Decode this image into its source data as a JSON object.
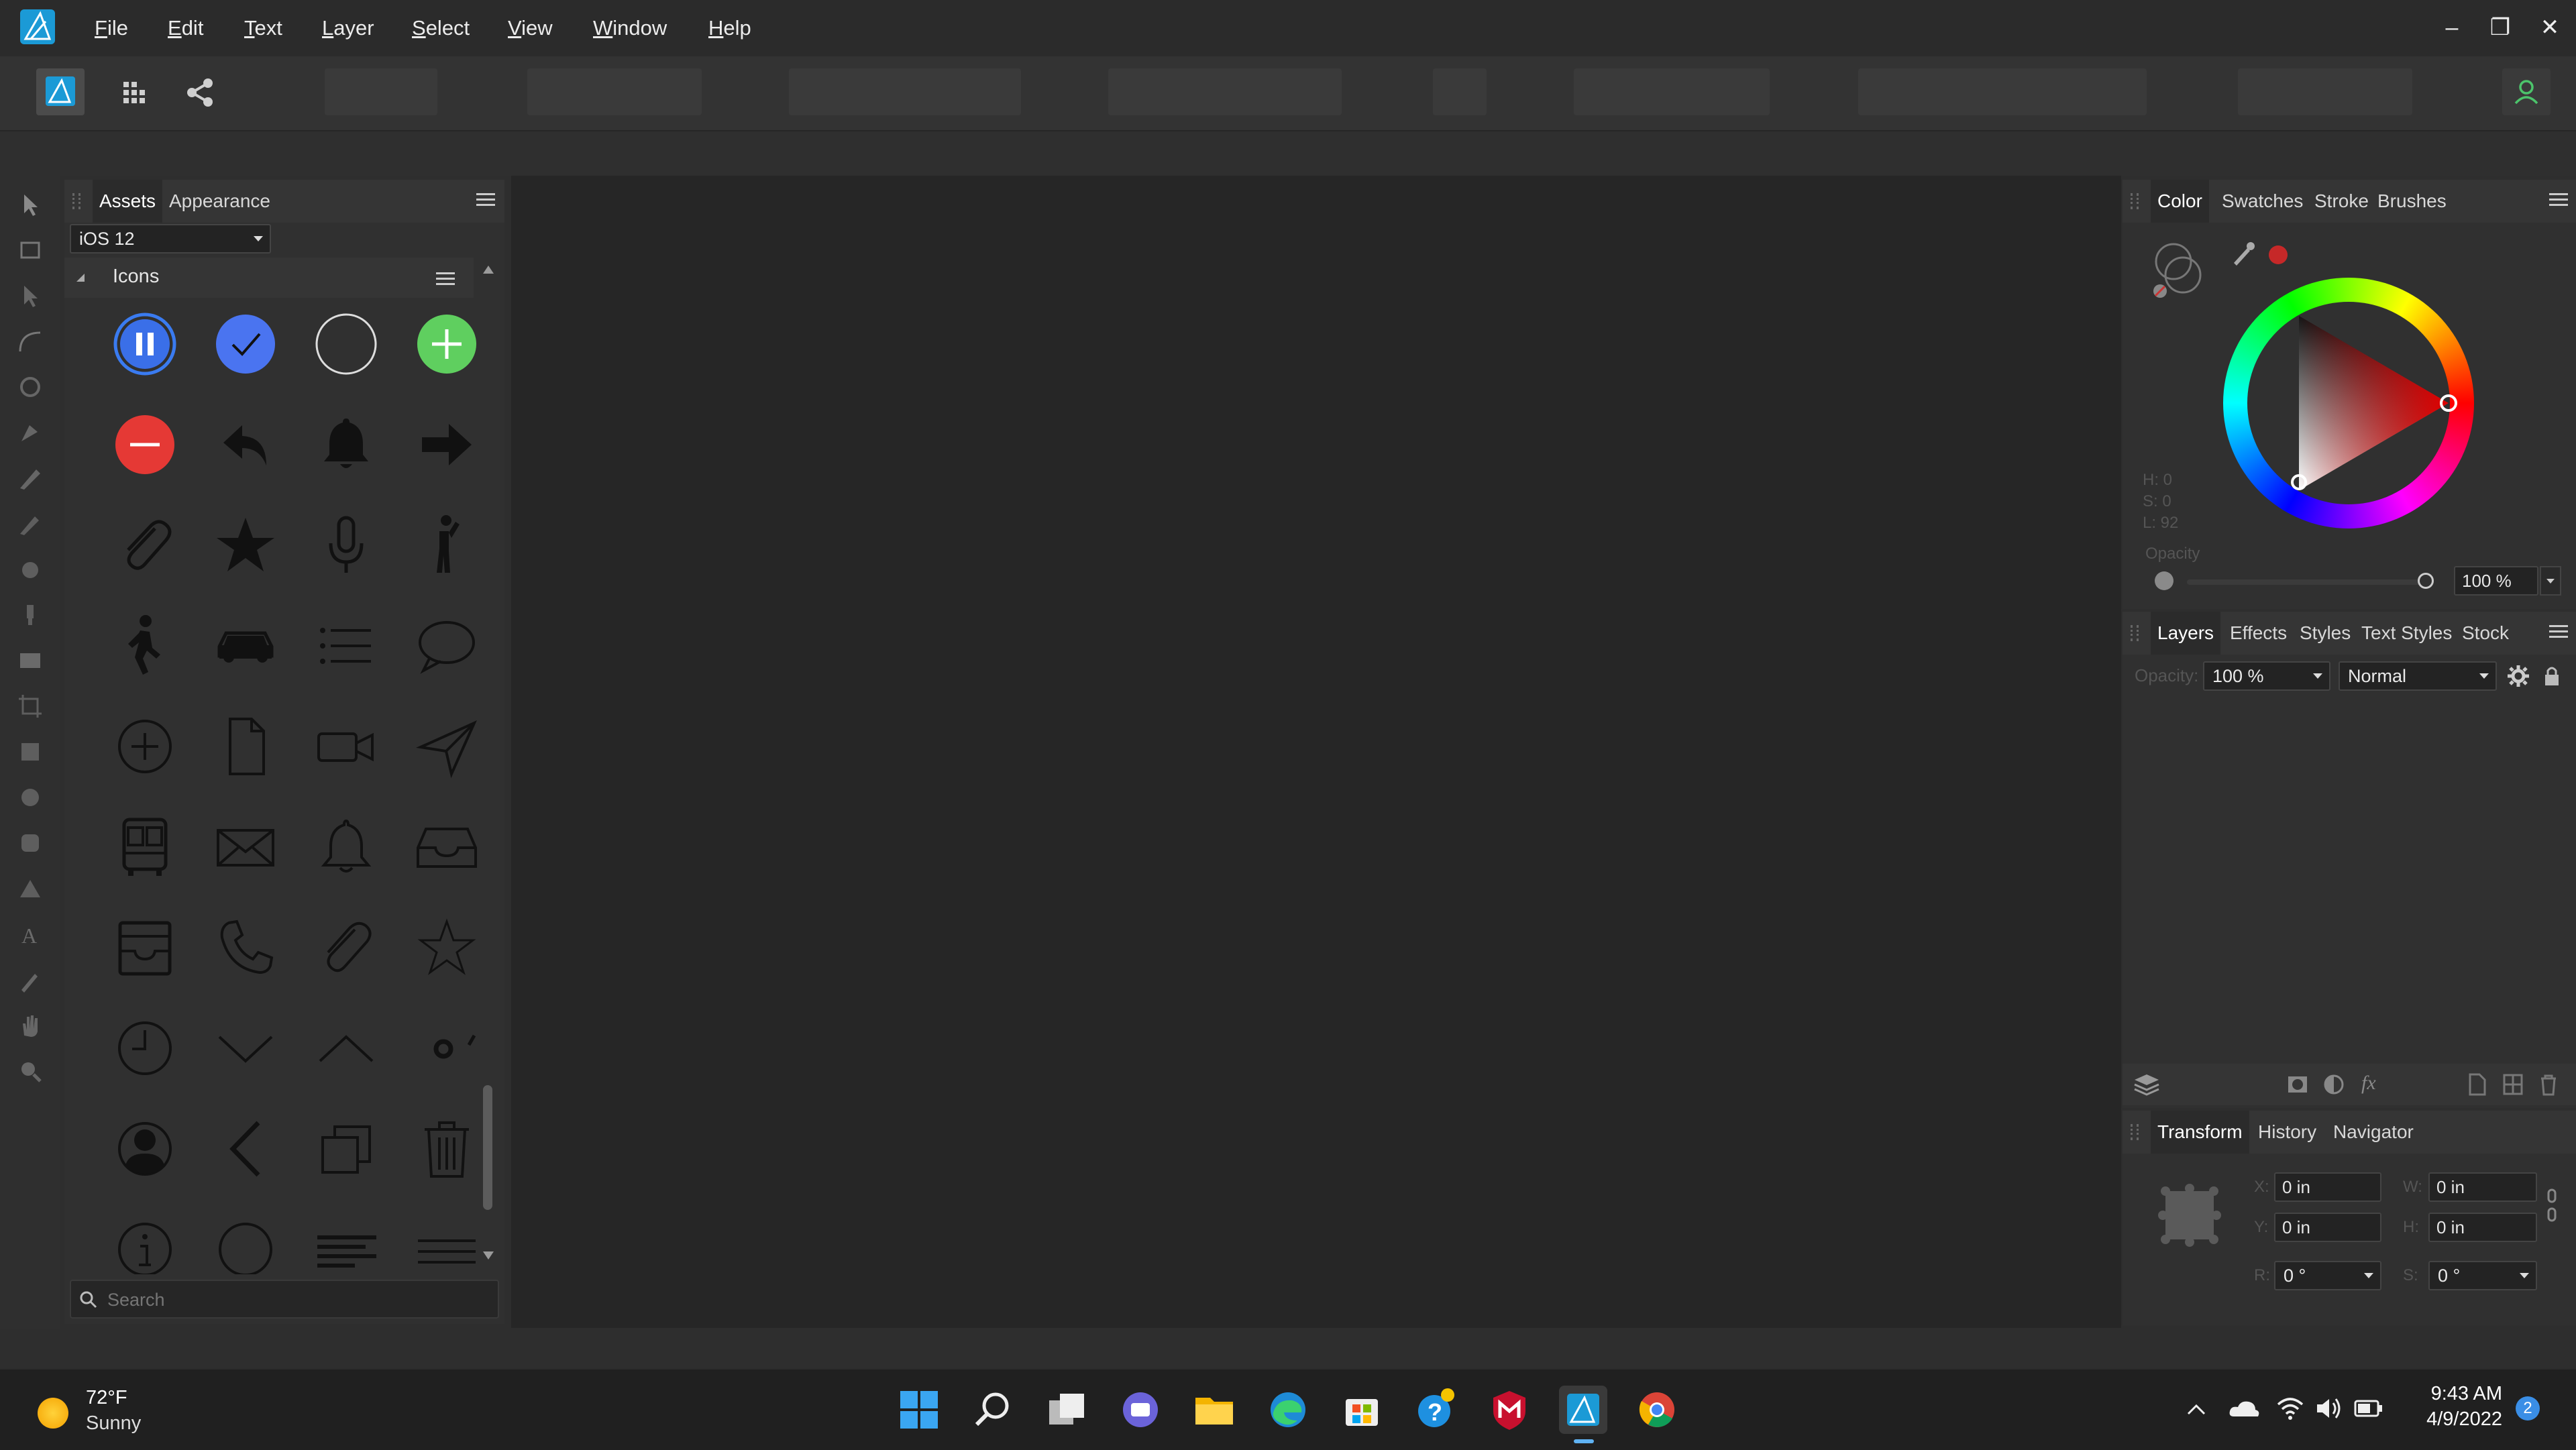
{
  "app": {
    "name": "Affinity Designer"
  },
  "menu": [
    "File",
    "Edit",
    "Text",
    "Layer",
    "Select",
    "View",
    "Window",
    "Help"
  ],
  "menu_underline": [
    "F",
    "E",
    "T",
    "L",
    "S",
    "V",
    "W",
    "H"
  ],
  "window_controls": {
    "minimize": "–",
    "restore": "❐",
    "close": "✕"
  },
  "assets_panel": {
    "tabs": [
      "Assets",
      "Appearance"
    ],
    "category_select": "iOS 12",
    "section_title": "Icons",
    "icons": [
      "pause-circle-icon",
      "checkmark-circle-icon",
      "empty-circle-icon",
      "add-circle-icon",
      "remove-circle-icon",
      "reply-arrow-icon",
      "bell-filled-icon",
      "forward-arrow-icon",
      "paperclip-icon",
      "star-filled-icon",
      "microphone-icon",
      "person-standing-icon",
      "walking-person-icon",
      "car-icon",
      "list-icon",
      "speech-bubble-icon",
      "plus-circle-outline-icon",
      "document-icon",
      "video-camera-icon",
      "send-paperplane-icon",
      "bus-icon",
      "envelope-icon",
      "bell-outline-icon",
      "inbox-tray-icon",
      "archive-box-icon",
      "phone-icon",
      "paperclip-outline-icon",
      "star-outline-icon",
      "clock-icon",
      "chevron-down-icon",
      "chevron-up-icon",
      "loading-spinner-icon",
      "person-silhouette-icon",
      "chevron-left-icon",
      "copy-windows-icon",
      "trash-icon",
      "info-circle-icon",
      "circle-outline-icon",
      "text-align-icon",
      "menu-lines-icon"
    ],
    "search_placeholder": "Search"
  },
  "color_panel": {
    "tabs": [
      "Color",
      "Swatches",
      "Stroke",
      "Brushes"
    ],
    "hsl": {
      "h": "H: 0",
      "s": "S: 0",
      "l": "L: 92"
    },
    "opacity_label": "Opacity",
    "opacity_value": "100 %",
    "opacity_fraction": 1.0,
    "accent_color": "#e03030"
  },
  "layers_panel": {
    "tabs": [
      "Layers",
      "Effects",
      "Styles",
      "Text Styles",
      "Stock"
    ],
    "opacity_label": "Opacity:",
    "opacity_value": "100 %",
    "blend_mode": "Normal",
    "fx_label": "fx"
  },
  "transform_panel": {
    "tabs": [
      "Transform",
      "History",
      "Navigator"
    ],
    "x_label": "X:",
    "x": "0 in",
    "y_label": "Y:",
    "y": "0 in",
    "w_label": "W:",
    "w": "0 in",
    "h_label": "H:",
    "h": "0 in",
    "r_label": "R:",
    "r": "0 °",
    "s_label": "S:",
    "s": "0 °"
  },
  "taskbar": {
    "weather_temp": "72°F",
    "weather_desc": "Sunny",
    "time": "9:43 AM",
    "date": "4/9/2022",
    "notification_count": "2"
  }
}
